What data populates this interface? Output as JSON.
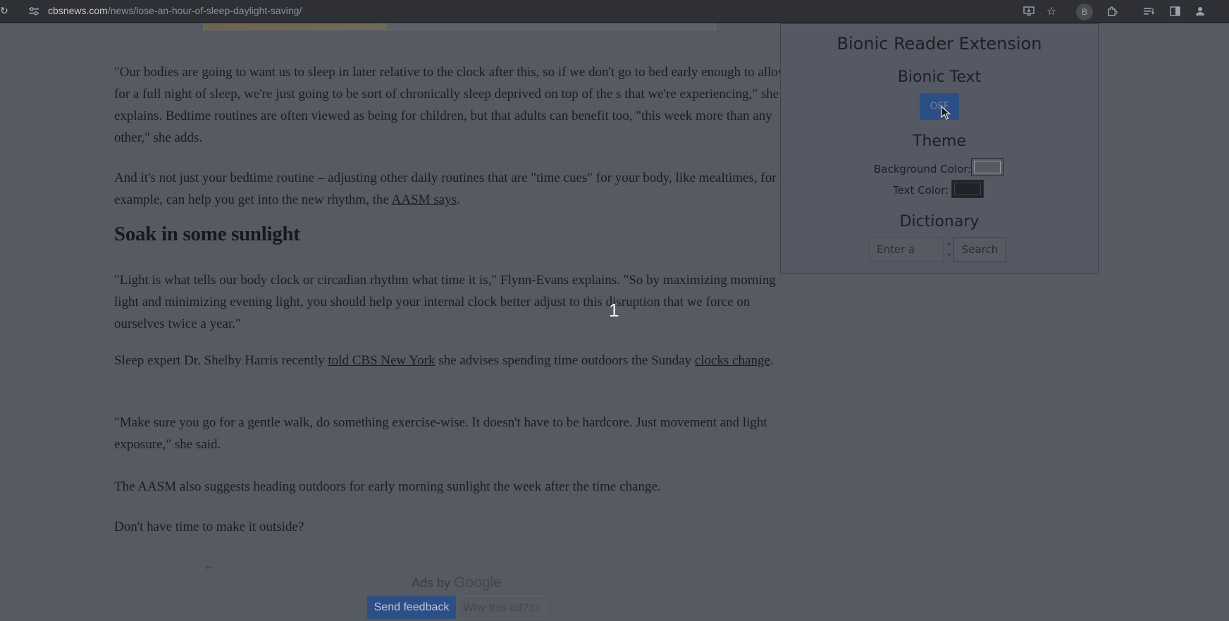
{
  "browser": {
    "url_host": "cbsnews.com",
    "url_path": "/news/lose-an-hour-of-sleep-daylight-saving/",
    "extension_badge": "B"
  },
  "article": {
    "para1": "\"Our bodies are going to want us to sleep in later relative to the clock after this, so if we don't go to bed early enough to allow for a full night of sleep, we're just going to be sort of chronically sleep deprived on top of the s that we're experiencing,\" she explains. Bedtime routines are often viewed as being for children, but that adults can benefit too, \"this week more than any other,\" she adds.",
    "para2_text": "And it's not just your bedtime routine – adjusting other daily routines that are \"time cues\" for your body, like mealtimes, for example, can help you get into the new rhythm, the ",
    "para2_link": "AASM says",
    "para2_end": ".",
    "heading": "Soak in some sunlight",
    "para3": "\"Light is what tells our body clock or circadian rhythm what time it is,\" Flynn-Evans explains. \"So by maximizing morning light and minimizing evening light, you should help your internal clock better adjust to this disruption that we force on ourselves twice a year.\"",
    "para4_text1": "Sleep expert Dr. Shelby Harris recently ",
    "para4_link1": "told CBS New York",
    "para4_text2": " she advises spending time outdoors the Sunday ",
    "para4_link2": "clocks change",
    "para4_end": ".",
    "para5": "\"Make sure you go for a gentle walk, do something exercise-wise. It doesn't have to be hardcore. Just movement and light exposure,\" she said.",
    "para6": "The AASM also suggests heading outdoors for early morning sunlight the week after the time change.",
    "para7": "Don't have time to make it outside?",
    "page_counter": "1"
  },
  "ads": {
    "ads_by": "Ads by ",
    "google": "Google",
    "send_feedback": "Send feedback",
    "why_ad": "Why this ad? ▷"
  },
  "popup": {
    "title": "Bionic Reader Extension",
    "bionic_title": "Bionic Text",
    "toggle_label": "OFF",
    "theme_title": "Theme",
    "bg_color_label": "Background Color:",
    "text_color_label": "Text Color:",
    "dictionary_title": "Dictionary",
    "dict_placeholder": "Enter a",
    "search_label": "Search"
  }
}
